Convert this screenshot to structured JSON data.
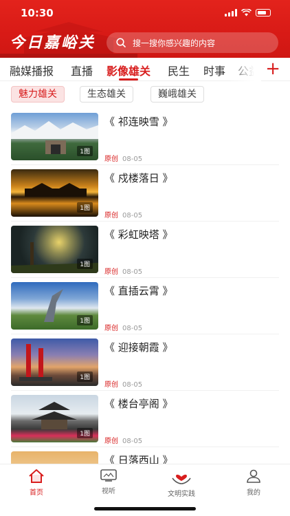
{
  "status": {
    "time": "10:30"
  },
  "header": {
    "title": "今日嘉峪关",
    "search_placeholder": "搜一搜你感兴趣的内容",
    "accent": "#d81e1e"
  },
  "tabs": [
    {
      "label": "融媒播报"
    },
    {
      "label": "直播"
    },
    {
      "label": "影像雄关",
      "active": true
    },
    {
      "label": "民生"
    },
    {
      "label": "时事"
    },
    {
      "label": "公益"
    }
  ],
  "tab_add_icon": "plus-icon",
  "chips": [
    {
      "label": "魅力雄关",
      "active": true
    },
    {
      "label": "生态雄关"
    },
    {
      "label": "巍峨雄关"
    }
  ],
  "feed": [
    {
      "title": "《 祁连映雪 》",
      "badge": "原创",
      "date": "08-05",
      "count": "1图"
    },
    {
      "title": "《 戍楼落日 》",
      "badge": "原创",
      "date": "08-05",
      "count": "1图"
    },
    {
      "title": "《 彩虹映塔 》",
      "badge": "原创",
      "date": "08-05",
      "count": "1图"
    },
    {
      "title": "《 直插云霄 》",
      "badge": "原创",
      "date": "08-05",
      "count": "1图"
    },
    {
      "title": "《 迎接朝霞 》",
      "badge": "原创",
      "date": "08-05",
      "count": "1图"
    },
    {
      "title": "《 楼台亭阁 》",
      "badge": "原创",
      "date": "08-05",
      "count": "1图"
    },
    {
      "title": "《 日落西山 》",
      "badge": "",
      "date": "",
      "count": ""
    }
  ],
  "bottom_nav": [
    {
      "label": "首页",
      "icon": "home-icon",
      "active": true
    },
    {
      "label": "视听",
      "icon": "tv-icon"
    },
    {
      "label": "文明实践",
      "icon": "heart-hands-icon"
    },
    {
      "label": "我的",
      "icon": "user-icon"
    }
  ]
}
